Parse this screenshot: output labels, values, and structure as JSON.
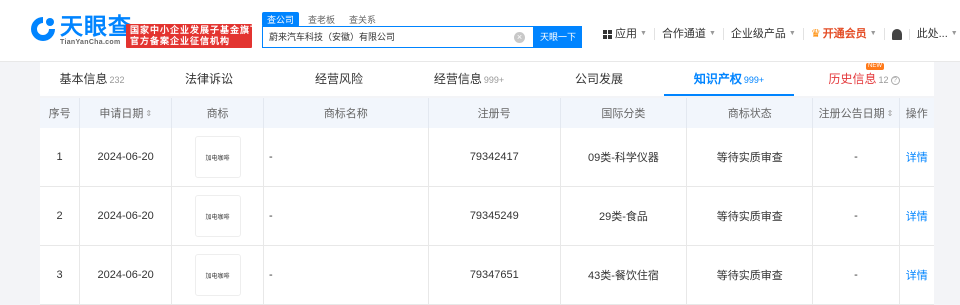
{
  "header": {
    "logo_cn": "天眼查",
    "logo_en": "TianYanCha.com",
    "gov_badge_line1": "国家中小企业发展子基金旗下",
    "gov_badge_line2": "官方备案企业征信机构",
    "search_tabs": [
      "查公司",
      "查老板",
      "查关系"
    ],
    "search_value": "蔚来汽车科技（安徽）有限公司",
    "search_button": "天眼一下",
    "nav": {
      "apps": "应用",
      "partner": "合作通道",
      "enterprise": "企业级产品",
      "vip": "开通会员",
      "user": "此处..."
    }
  },
  "tabs": [
    {
      "label": "基本信息",
      "count": "232"
    },
    {
      "label": "法律诉讼",
      "count": ""
    },
    {
      "label": "经营风险",
      "count": ""
    },
    {
      "label": "经营信息",
      "count": "999+"
    },
    {
      "label": "公司发展",
      "count": ""
    },
    {
      "label": "知识产权",
      "count": "999+"
    },
    {
      "label": "历史信息",
      "count": "12"
    }
  ],
  "history_badge": "NEW",
  "table": {
    "headers": [
      "序号",
      "申请日期",
      "商标",
      "商标名称",
      "注册号",
      "国际分类",
      "商标状态",
      "注册公告日期",
      "操作"
    ],
    "rows": [
      {
        "no": "1",
        "date": "2024-06-20",
        "logo_text": "加电咖啡",
        "name": "-",
        "reg_no": "79342417",
        "class": "09类-科学仪器",
        "status": "等待实质审查",
        "pub_date": "-",
        "action": "详情"
      },
      {
        "no": "2",
        "date": "2024-06-20",
        "logo_text": "加电咖啡",
        "name": "-",
        "reg_no": "79345249",
        "class": "29类-食品",
        "status": "等待实质审查",
        "pub_date": "-",
        "action": "详情"
      },
      {
        "no": "3",
        "date": "2024-06-20",
        "logo_text": "加电咖啡",
        "name": "-",
        "reg_no": "79347651",
        "class": "43类-餐饮住宿",
        "status": "等待实质审查",
        "pub_date": "-",
        "action": "详情"
      }
    ]
  },
  "colors": {
    "brand": "#0084ff",
    "vip": "#e44d26",
    "badge_red": "#e33430"
  }
}
